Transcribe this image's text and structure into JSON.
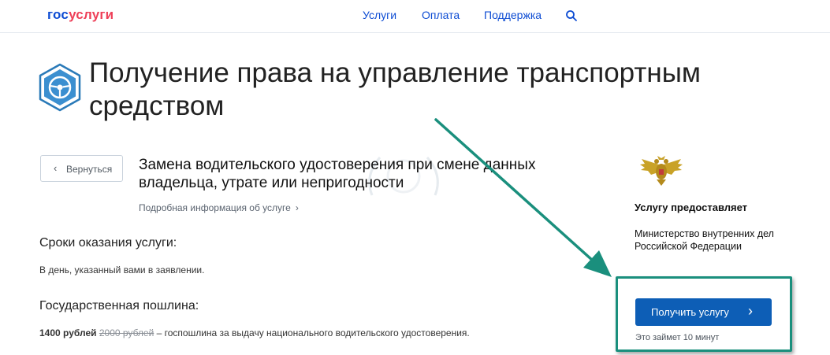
{
  "header": {
    "logo_part1": "гос",
    "logo_part2": "услуги",
    "nav": [
      "Услуги",
      "Оплата",
      "Поддержка"
    ]
  },
  "page": {
    "title_line1": "Получение права на управление транспортным",
    "title_line2": "средством"
  },
  "back_button": "Вернуться",
  "service": {
    "title_line1": "Замена водительского удостоверения при смене данных",
    "title_line2": "владельца, утрате или непригодности",
    "more_link": "Подробная информация об услуге"
  },
  "terms": {
    "heading": "Сроки оказания услуги:",
    "text": "В день, указанный вами в заявлении."
  },
  "fee": {
    "heading": "Государственная пошлина:",
    "amount": "1400 рублей",
    "old_amount": "2000 рублей",
    "description": " – госпошлина за выдачу национального водительского удостоверения."
  },
  "provider": {
    "heading": "Услугу предоставляет",
    "name_line1": "Министерство внутренних дел",
    "name_line2": "Российской Федерации"
  },
  "cta": {
    "button_label": "Получить услугу",
    "time_note": "Это займет 10 минут"
  },
  "colors": {
    "brand_blue": "#0d4cd3",
    "brand_red": "#ee3f58",
    "button_blue": "#0d5eb6",
    "annotation_teal": "#1a8f7d"
  }
}
